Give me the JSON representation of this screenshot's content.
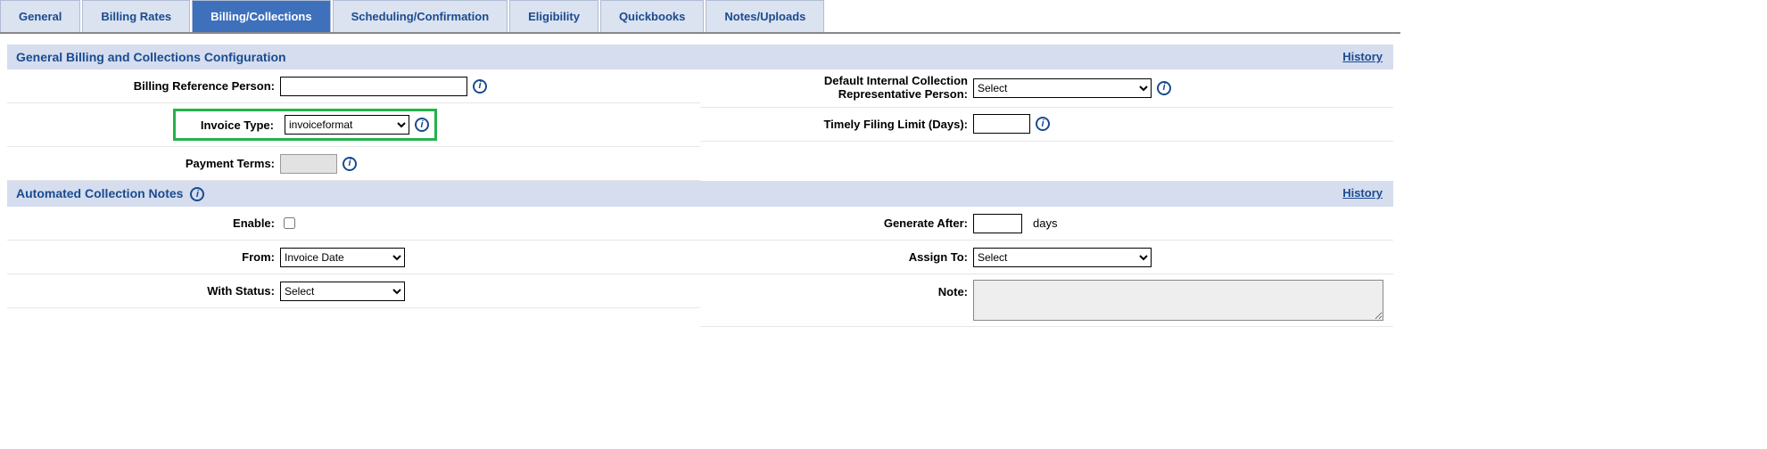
{
  "tabs": {
    "general": "General",
    "billing_rates": "Billing Rates",
    "billing_collections": "Billing/Collections",
    "scheduling_confirmation": "Scheduling/Confirmation",
    "eligibility": "Eligibility",
    "quickbooks": "Quickbooks",
    "notes_uploads": "Notes/Uploads"
  },
  "links": {
    "history": "History"
  },
  "section1": {
    "title": "General Billing and Collections Configuration",
    "billing_ref_label": "Billing Reference Person:",
    "billing_ref_value": "",
    "invoice_type_label": "Invoice Type:",
    "invoice_type_value": "invoiceformat",
    "payment_terms_label": "Payment Terms:",
    "payment_terms_value": "",
    "default_rep_label_l1": "Default Internal Collection",
    "default_rep_label_l2": "Representative Person:",
    "default_rep_value": "Select",
    "timely_filing_label": "Timely Filing Limit (Days):",
    "timely_filing_value": ""
  },
  "section2": {
    "title": "Automated Collection Notes",
    "enable_label": "Enable:",
    "from_label": "From:",
    "from_value": "Invoice Date",
    "with_status_label": "With Status:",
    "with_status_value": "Select",
    "generate_after_label": "Generate After:",
    "generate_after_value": "",
    "generate_after_suffix": "days",
    "assign_to_label": "Assign To:",
    "assign_to_value": "Select",
    "note_label": "Note:",
    "note_value": ""
  }
}
